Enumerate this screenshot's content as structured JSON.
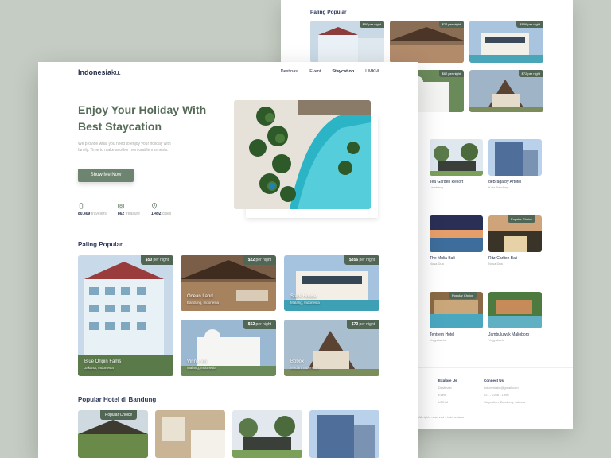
{
  "nav": {
    "logo_main": "Indonesia",
    "logo_suffix": "ku.",
    "links": [
      "Destinasi",
      "Event",
      "Staycation",
      "UMKM"
    ]
  },
  "hero": {
    "title": "Enjoy Your Holiday With Best Staycation",
    "subtitle": "We provide what you need to enjoy your holiday with family. Time to make another memorable moments.",
    "cta_label": "Show Me Now",
    "stats": [
      {
        "icon": "traveler-icon",
        "value": "80,409",
        "label": "travelers"
      },
      {
        "icon": "camera-icon",
        "value": "862",
        "label": "treasure"
      },
      {
        "icon": "location-icon",
        "value": "1,492",
        "label": "cities"
      }
    ]
  },
  "popular": {
    "title": "Paling Popular",
    "cards": [
      {
        "price": "$50",
        "unit": "per night",
        "name": "Blue Origin Fams",
        "location": "Jakarta, Indonesia"
      },
      {
        "price": "$22",
        "unit": "per night",
        "name": "Ocean Land",
        "location": "Bandung, Indonesia"
      },
      {
        "price": "$856",
        "unit": "per night",
        "name": "Stark House",
        "location": "Malang, Indonesia"
      },
      {
        "price": "$62",
        "unit": "per night",
        "name": "Vinna Vill",
        "location": "Malang, Indonesia"
      },
      {
        "price": "$72",
        "unit": "per night",
        "name": "Bobox",
        "location": "Medan, Indonesia"
      }
    ]
  },
  "bandung": {
    "title": "Popular Hotel di Bandung",
    "badge": "Popular Choice"
  },
  "back_page": {
    "popular_title": "Paling Popular",
    "prices": [
      "$50 per night",
      "$22 per night",
      "$856 per night",
      "$62 per night",
      "$72 per night"
    ],
    "hotels": [
      {
        "name": "Tea Garden Resort",
        "location": "Lembang"
      },
      {
        "name": "deBraga by Artotel",
        "location": "Kota Bandung"
      },
      {
        "name": "The Mulia Bali",
        "location": "Nusa Dua"
      },
      {
        "name": "Ritz-Carlton Bali",
        "location": "Nusa Dua"
      },
      {
        "name": "Tentrem Hotel",
        "location": "Yogyakarta"
      },
      {
        "name": "Jambuluwuk Malioboro",
        "location": "Yogyakarta"
      }
    ],
    "badge": "Popular Choice",
    "footer": {
      "explore_title": "Explore Us",
      "explore_links": [
        "Destinasi",
        "Event",
        "UMKM"
      ],
      "contact_title": "Connect Us",
      "contact_lines": [
        "indonesiaku@gmail.com",
        "021 - 2208 - 1996",
        "Staycation, Bandung, Jakarta"
      ],
      "copyright": "All rights reserved • Indonesiaku"
    }
  }
}
